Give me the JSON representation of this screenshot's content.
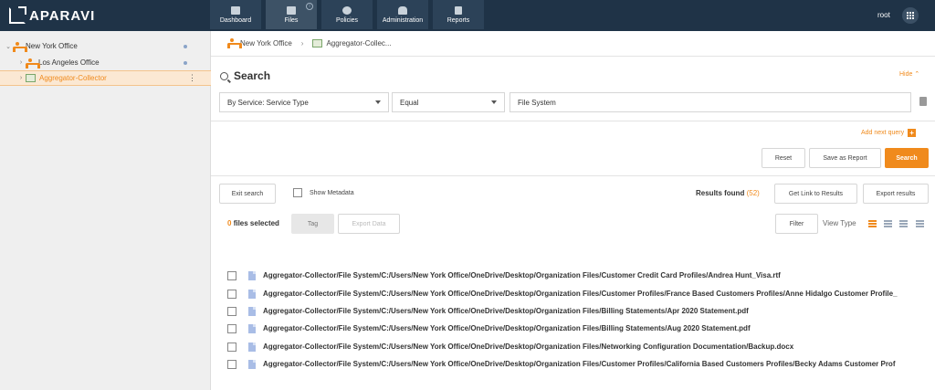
{
  "app": {
    "brand": "APARAVI",
    "accent": "#f08a1c",
    "topbar_color": "#1f3347"
  },
  "nav": [
    {
      "label": "Dashboard",
      "icon": "dashboard-icon"
    },
    {
      "label": "Files",
      "icon": "folder-icon",
      "active": true
    },
    {
      "label": "Policies",
      "icon": "gear-icon"
    },
    {
      "label": "Administration",
      "icon": "users-icon"
    },
    {
      "label": "Reports",
      "icon": "report-icon"
    }
  ],
  "user": {
    "name": "root"
  },
  "sidebar": {
    "items": [
      {
        "label": "New York Office",
        "icon": "node-icon"
      },
      {
        "label": "Los Angeles Office",
        "icon": "node-icon"
      },
      {
        "label": "Aggregator-Collector",
        "icon": "collector-icon",
        "selected": true
      }
    ]
  },
  "breadcrumb": {
    "items": [
      "New York Office",
      "Aggregator-Collec..."
    ]
  },
  "search": {
    "title": "Search",
    "hide_label": "Hide",
    "field_label": "By Service: Service Type",
    "operator": "Equal",
    "value": "File System",
    "add_query_label": "Add next query",
    "reset_label": "Reset",
    "save_report_label": "Save as Report",
    "search_label": "Search"
  },
  "results": {
    "exit_label": "Exit search",
    "show_metadata_label": "Show Metadata",
    "found_label": "Results found",
    "found_count": "(52)",
    "get_link_label": "Get Link to Results",
    "export_label": "Export results",
    "selected_count": "0",
    "selected_label": "files selected",
    "tag_label": "Tag",
    "export_data_label": "Export Data",
    "filter_label": "Filter",
    "view_type_label": "View Type",
    "files": [
      "Aggregator-Collector/File System/C:/Users/New York Office/OneDrive/Desktop/Organization Files/Customer Credit Card Profiles/Andrea Hunt_Visa.rtf",
      "Aggregator-Collector/File System/C:/Users/New York Office/OneDrive/Desktop/Organization Files/Customer Profiles/France Based Customers Profiles/Anne Hidalgo Customer Profile_",
      "Aggregator-Collector/File System/C:/Users/New York Office/OneDrive/Desktop/Organization Files/Billing Statements/Apr 2020 Statement.pdf",
      "Aggregator-Collector/File System/C:/Users/New York Office/OneDrive/Desktop/Organization Files/Billing Statements/Aug 2020 Statement.pdf",
      "Aggregator-Collector/File System/C:/Users/New York Office/OneDrive/Desktop/Organization Files/Networking Configuration Documentation/Backup.docx",
      "Aggregator-Collector/File System/C:/Users/New York Office/OneDrive/Desktop/Organization Files/Customer Profiles/California Based Customers Profiles/Becky Adams Customer Prof"
    ]
  }
}
